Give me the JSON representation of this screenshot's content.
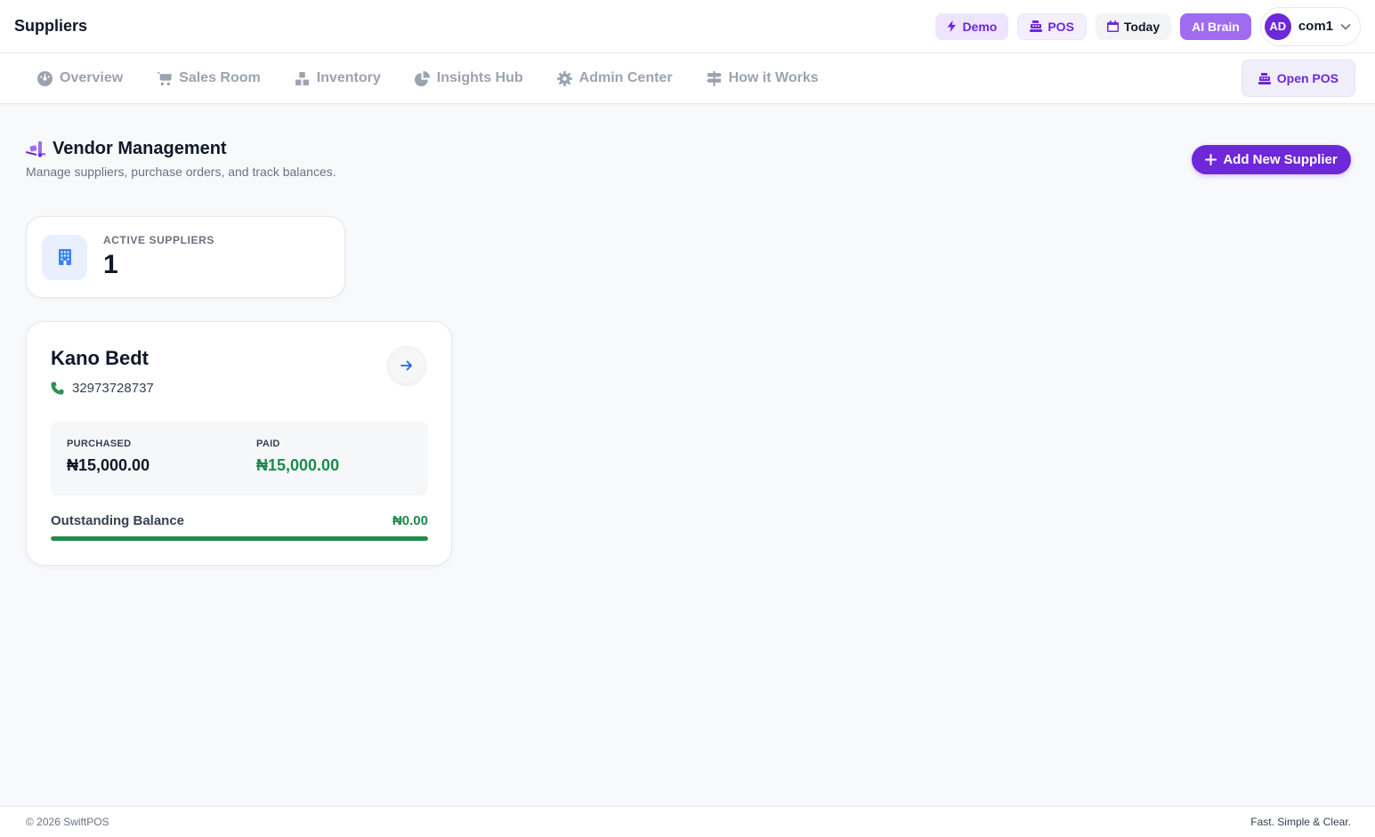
{
  "header": {
    "title": "Suppliers",
    "demo_label": "Demo",
    "pos_label": "POS",
    "today_label": "Today",
    "ai_label": "AI Brain",
    "user_initials": "AD",
    "user_name": "com1"
  },
  "nav": {
    "items": [
      {
        "label": "Overview",
        "icon": "gauge-icon"
      },
      {
        "label": "Sales Room",
        "icon": "cart-icon"
      },
      {
        "label": "Inventory",
        "icon": "boxes-icon"
      },
      {
        "label": "Insights Hub",
        "icon": "pie-chart-icon"
      },
      {
        "label": "Admin Center",
        "icon": "gear-icon"
      },
      {
        "label": "How it Works",
        "icon": "signpost-icon"
      }
    ],
    "open_pos_label": "Open POS"
  },
  "page": {
    "title": "Vendor Management",
    "subtitle": "Manage suppliers, purchase orders, and track balances.",
    "add_button_label": "Add New Supplier"
  },
  "stats": {
    "active_suppliers_label": "ACTIVE SUPPLIERS",
    "active_suppliers_value": "1"
  },
  "supplier": {
    "name": "Kano Bedt",
    "phone": "32973728737",
    "purchased_label": "PURCHASED",
    "purchased_value": "₦15,000.00",
    "paid_label": "PAID",
    "paid_value": "₦15,000.00",
    "balance_label": "Outstanding Balance",
    "balance_value": "₦0.00",
    "paid_fraction": 1.0
  },
  "footer": {
    "copyright": "© 2026 SwiftPOS",
    "tagline": "Fast. Simple & Clear."
  },
  "colors": {
    "accent": "#6d28d9",
    "success": "#1e8a4c",
    "muted": "#9ca3af"
  }
}
